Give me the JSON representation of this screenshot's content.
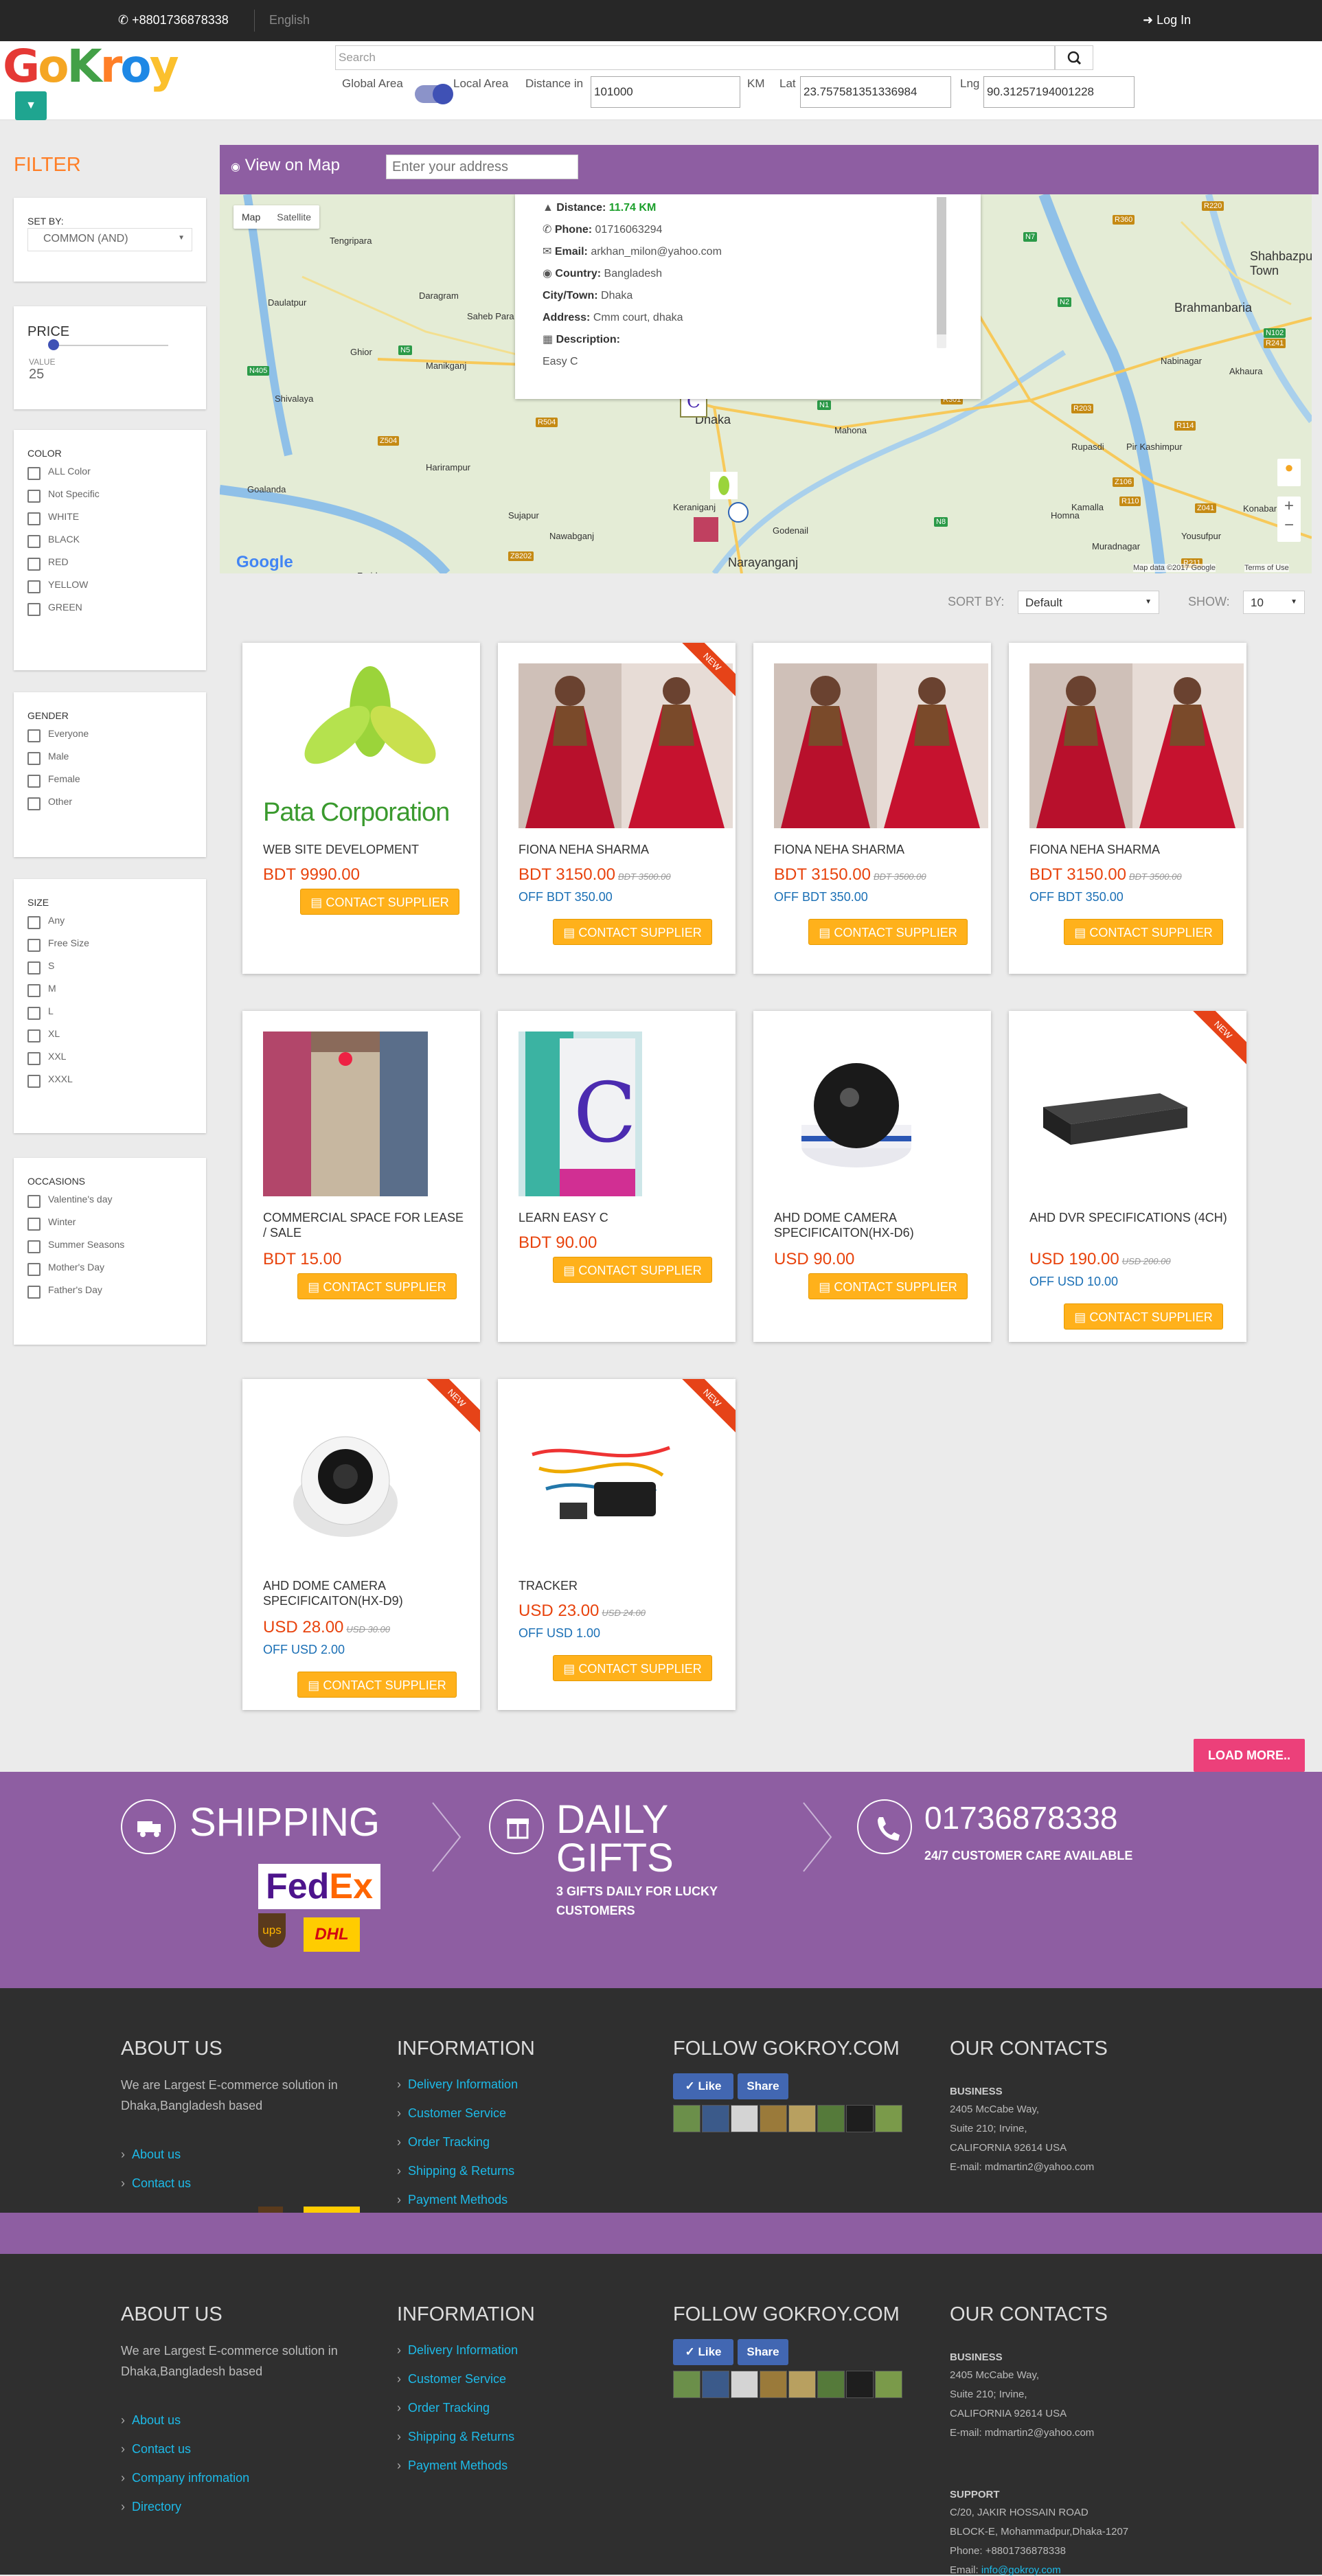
{
  "topbar": {
    "phone": "+8801736878338",
    "language": "English",
    "login": "Log In"
  },
  "brand": {
    "logo_letters": [
      "G",
      "o",
      "K",
      "r",
      "o",
      "y"
    ],
    "logo_colors": [
      "#e53935",
      "#f5a623",
      "#43a047",
      "#ff7f27",
      "#1e88e5",
      "#fbc02d"
    ]
  },
  "search": {
    "placeholder": "Search"
  },
  "geo": {
    "global_label": "Global Area",
    "local_label": "Local Area",
    "distance_label": "Distance in",
    "distance_value": "101000",
    "unit": "KM",
    "lat_label": "Lat",
    "lat_value": "23.757581351336984",
    "lng_label": "Lng",
    "lng_value": "90.31257194001228"
  },
  "filter": {
    "title": "FILTER",
    "set_by_label": "SET BY:",
    "set_by_value": "COMMON (AND)",
    "price_label": "PRICE",
    "value_label": "VALUE",
    "price_value": "25",
    "color_label": "COLOR",
    "colors": [
      "ALL Color",
      "Not Specific",
      "WHITE",
      "BLACK",
      "RED",
      "YELLOW",
      "GREEN"
    ],
    "gender_label": "GENDER",
    "genders": [
      "Everyone",
      "Male",
      "Female",
      "Other"
    ],
    "size_label": "SIZE",
    "sizes": [
      "Any",
      "Free Size",
      "S",
      "M",
      "L",
      "XL",
      "XXL",
      "XXXL"
    ],
    "occasions_label": "OCCASIONS",
    "occasions": [
      "Valentine's day",
      "Winter",
      "Summer Seasons",
      "Mother's Day",
      "Father's Day"
    ]
  },
  "map": {
    "title": "View on Map",
    "address_placeholder": "Enter your address",
    "tab_map": "Map",
    "tab_satellite": "Satellite",
    "info": {
      "distance_label": "Distance:",
      "distance_value": "11.74 KM",
      "phone_label": "Phone:",
      "phone_value": "01716063294",
      "email_label": "Email:",
      "email_value": "arkhan_milon@yahoo.com",
      "country_label": "Country:",
      "country_value": "Bangladesh",
      "city_label": "City/Town:",
      "city_value": "Dhaka",
      "address_label": "Address:",
      "address_value": "Cmm court, dhaka",
      "description_label": "Description:",
      "description_value": "Easy C"
    },
    "places": [
      "Tengripara",
      "Daulatpur",
      "Daragram",
      "Saheb Para",
      "Ghior",
      "Manikganj",
      "Shivalaya",
      "Harirampur",
      "Goalanda",
      "Sujapur",
      "Nawabganj",
      "Dhaka",
      "Mahona",
      "Keraniganj",
      "Godenail",
      "Narayanganj",
      "Brahmanbaria",
      "Shahbazpur Town",
      "Nabinagar",
      "Akhaura",
      "Rupasdi",
      "Pir Kashimpur",
      "Homna",
      "Kamalla",
      "Muradnagar",
      "Yousufpur",
      "Konabari",
      "Faridpur"
    ],
    "roads": [
      "N405",
      "N5",
      "R504",
      "Z504",
      "R360",
      "R220",
      "N7",
      "N2",
      "N102",
      "R203",
      "R211",
      "R114",
      "Z106",
      "R110",
      "Z041",
      "N8",
      "Z8202",
      "R241",
      "N1",
      "R301"
    ],
    "attribution": "Map data ©2017 Google",
    "terms": "Terms of Use",
    "google": "Google"
  },
  "sort": {
    "label": "SORT BY:",
    "value": "Default",
    "show_label": "SHOW:",
    "show_value": "10"
  },
  "products": [
    {
      "name": "WEB SITE DEVELOPMENT",
      "price": "BDT 9990.00",
      "old": "",
      "off": "",
      "btn": "CONTACT SUPPLIER",
      "logo_text": "Pata Corporation",
      "isnew": false
    },
    {
      "name": "FIONA NEHA SHARMA",
      "price": "BDT 3150.00",
      "old": "BDT 3500.00",
      "off": "OFF BDT 350.00",
      "btn": "CONTACT SUPPLIER",
      "isnew": true,
      "new": "NEW"
    },
    {
      "name": "FIONA NEHA SHARMA",
      "price": "BDT 3150.00",
      "old": "BDT 3500.00",
      "off": "OFF BDT 350.00",
      "btn": "CONTACT SUPPLIER",
      "isnew": false
    },
    {
      "name": "FIONA NEHA SHARMA",
      "price": "BDT 3150.00",
      "old": "BDT 3500.00",
      "off": "OFF BDT 350.00",
      "btn": "CONTACT SUPPLIER",
      "isnew": false
    },
    {
      "name": "COMMERCIAL SPACE FOR LEASE / SALE",
      "price": "BDT 15.00",
      "old": "",
      "off": "",
      "btn": "CONTACT SUPPLIER",
      "isnew": false
    },
    {
      "name": "LEARN EASY C",
      "price": "BDT 90.00",
      "old": "",
      "off": "",
      "btn": "CONTACT SUPPLIER",
      "isnew": false
    },
    {
      "name": "AHD DOME CAMERA SPECIFICAITON(HX-D6)",
      "price": "USD 90.00",
      "old": "",
      "off": "",
      "btn": "CONTACT SUPPLIER",
      "isnew": false
    },
    {
      "name": "AHD DVR SPECIFICATIONS (4CH)",
      "price": "USD 190.00",
      "old": "USD 200.00",
      "off": "OFF USD 10.00",
      "btn": "CONTACT SUPPLIER",
      "isnew": true,
      "new": "NEW"
    },
    {
      "name": "AHD DOME CAMERA SPECIFICAITON(HX-D9)",
      "price": "USD 28.00",
      "old": "USD 30.00",
      "off": "OFF USD 2.00",
      "btn": "CONTACT SUPPLIER",
      "isnew": true,
      "new": "NEW"
    },
    {
      "name": "TRACKER",
      "price": "USD 23.00",
      "old": "USD 24.00",
      "off": "OFF USD 1.00",
      "btn": "CONTACT SUPPLIER",
      "isnew": true,
      "new": "NEW"
    }
  ],
  "load_more": "LOAD MORE..",
  "shipping": {
    "title": "SHIPPING",
    "fedex_fed": "Fed",
    "fedex_ex": "Ex",
    "ups": "ups",
    "dhl": "DHL"
  },
  "gifts": {
    "title_line1": "DAILY",
    "title_line2": "GIFTS",
    "sub_line1": "3 GIFTS DAILY FOR LUCKY",
    "sub_line2": "CUSTOMERS"
  },
  "care": {
    "phone": "01736878338",
    "sub": "24/7 CUSTOMER CARE AVAILABLE"
  },
  "footer": {
    "about_title": "ABOUT US",
    "about_text_1": "We are Largest E-commerce solution in",
    "about_text_2": "Dhaka,Bangladesh based",
    "about_links": [
      "About us",
      "Contact us",
      "Company infromation",
      "Directory"
    ],
    "info_title": "INFORMATION",
    "info_links": [
      "Delivery Information",
      "Customer Service",
      "Order Tracking",
      "Shipping & Returns",
      "Payment Methods"
    ],
    "follow_title": "FOLLOW GOKROY.COM",
    "like": "Like",
    "share": "Share",
    "contacts_title": "OUR CONTACTS",
    "business_label": "BUSINESS",
    "business_lines": [
      "2405 McCabe Way,",
      "Suite 210; Irvine,",
      "CALIFORNIA 92614 USA",
      "E-mail: mdmartin2@yahoo.com"
    ],
    "support_label": "SUPPORT",
    "support_lines": [
      "C/20, JAKIR HOSSAIN ROAD",
      "BLOCK-E, Mohammadpur,Dhaka-1207",
      "Phone: +8801736878338"
    ],
    "support_email_label": "Email:",
    "support_email": "info@gokroy.com"
  }
}
